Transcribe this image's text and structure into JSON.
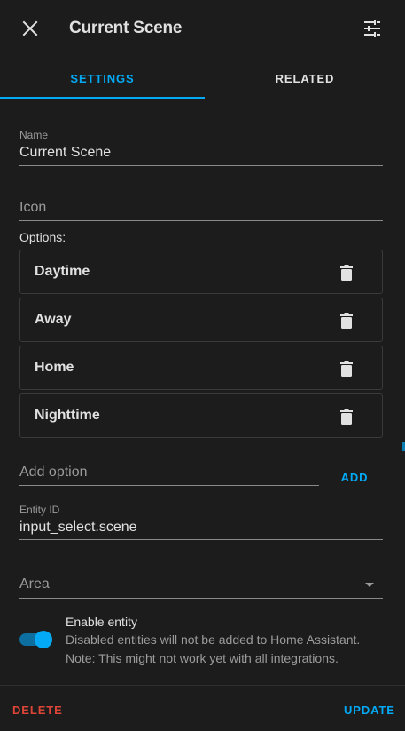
{
  "header": {
    "title": "Current Scene",
    "close_icon": "close-icon",
    "settings_icon": "tune-icon"
  },
  "tabs": [
    {
      "label": "SETTINGS",
      "active": true
    },
    {
      "label": "RELATED",
      "active": false
    }
  ],
  "form": {
    "name": {
      "label": "Name",
      "value": "Current Scene"
    },
    "icon": {
      "placeholder": "Icon"
    },
    "options_label": "Options:",
    "options": [
      {
        "label": "Daytime"
      },
      {
        "label": "Away"
      },
      {
        "label": "Home"
      },
      {
        "label": "Nighttime"
      }
    ],
    "add_option": {
      "placeholder": "Add option",
      "button_label": "ADD"
    },
    "entity_id": {
      "label": "Entity ID",
      "value": "input_select.scene"
    },
    "area": {
      "placeholder": "Area"
    },
    "enable_entity": {
      "title": "Enable entity",
      "description_line1": "Disabled entities will not be added to Home Assistant.",
      "description_line2": "Note: This might not work yet with all integrations.",
      "enabled": true
    }
  },
  "footer": {
    "delete_label": "DELETE",
    "update_label": "UPDATE"
  },
  "colors": {
    "accent": "#03a9f4",
    "danger": "#db4437",
    "background": "#1c1c1c"
  }
}
